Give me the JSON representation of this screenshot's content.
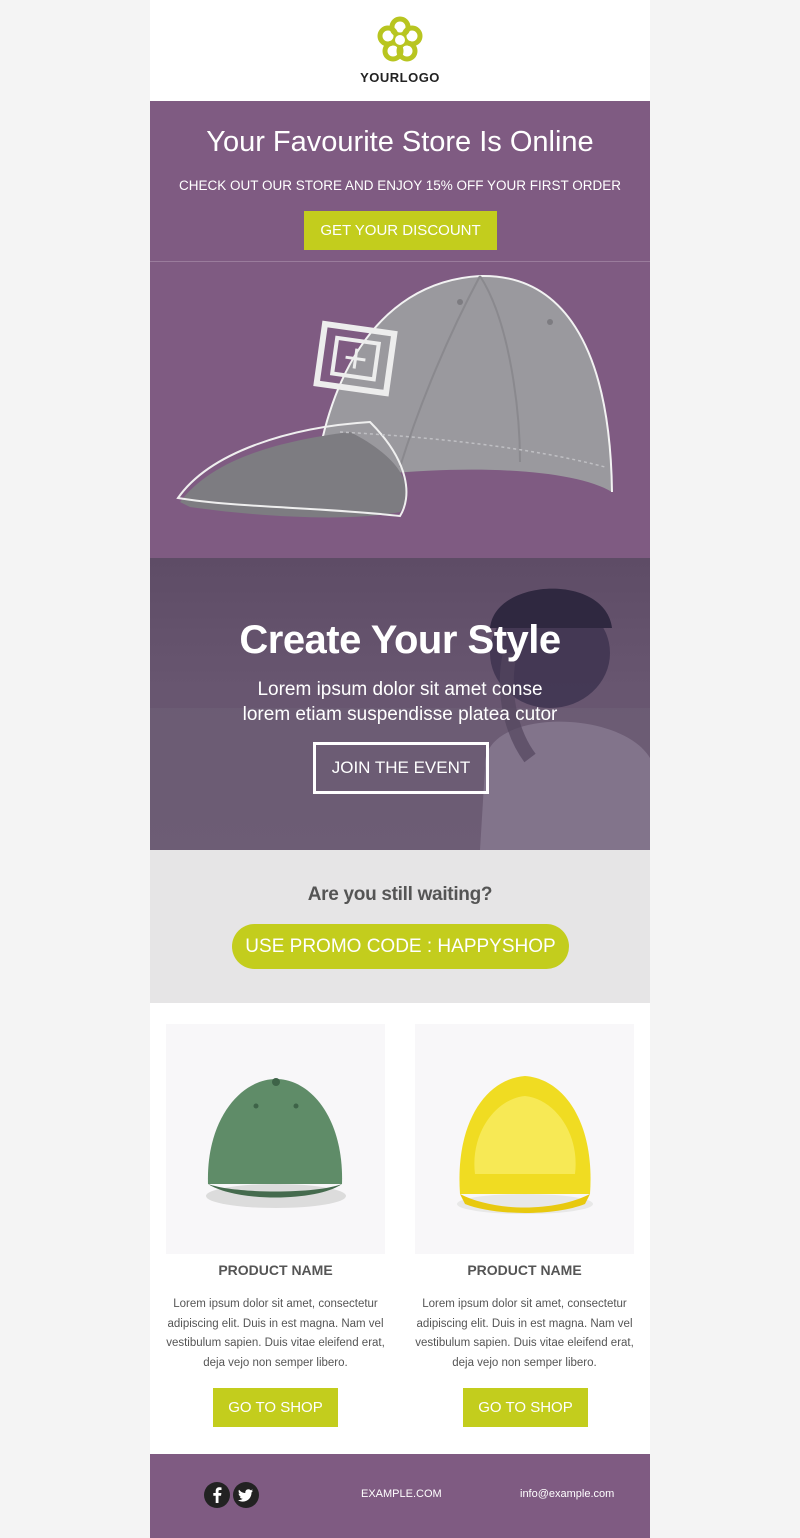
{
  "header": {
    "logo_text": "YOURLOGO"
  },
  "hero": {
    "title": "Your Favourite Store Is Online",
    "subtitle": "CHECK OUT OUR STORE AND ENJOY 15% OFF YOUR FIRST ORDER",
    "cta_label": "GET YOUR DISCOUNT"
  },
  "style_section": {
    "title": "Create Your Style",
    "body_line1": "Lorem ipsum dolor sit amet conse",
    "body_line2": "lorem etiam suspendisse platea cutor",
    "cta_label": "JOIN THE EVENT"
  },
  "waiting_section": {
    "title": "Are you still waiting?",
    "promo_label": "USE PROMO CODE : HAPPYSHOP"
  },
  "products": [
    {
      "name": "PRODUCT NAME",
      "description_lines": [
        "Lorem ipsum dolor sit amet, consectetur",
        "adipiscing elit. Duis in est magna. Nam vel",
        "vestibulum sapien. Duis vitae eleifend erat,",
        "deja vejo non semper libero."
      ],
      "cta_label": "GO TO SHOP"
    },
    {
      "name": "PRODUCT NAME",
      "description_lines": [
        "Lorem ipsum dolor sit amet, consectetur",
        "adipiscing elit. Duis in est magna. Nam vel",
        "vestibulum sapien. Duis vitae eleifend erat,",
        "deja vejo non semper libero."
      ],
      "cta_label": "GO TO SHOP"
    }
  ],
  "footer": {
    "social": [
      "facebook-icon",
      "twitter-icon"
    ],
    "website": "EXAMPLE.COM",
    "email": "info@example.com"
  },
  "colors": {
    "accent": "#c3cd1d",
    "purple": "#7f5b82",
    "grey_band": "#e6e5e6"
  }
}
